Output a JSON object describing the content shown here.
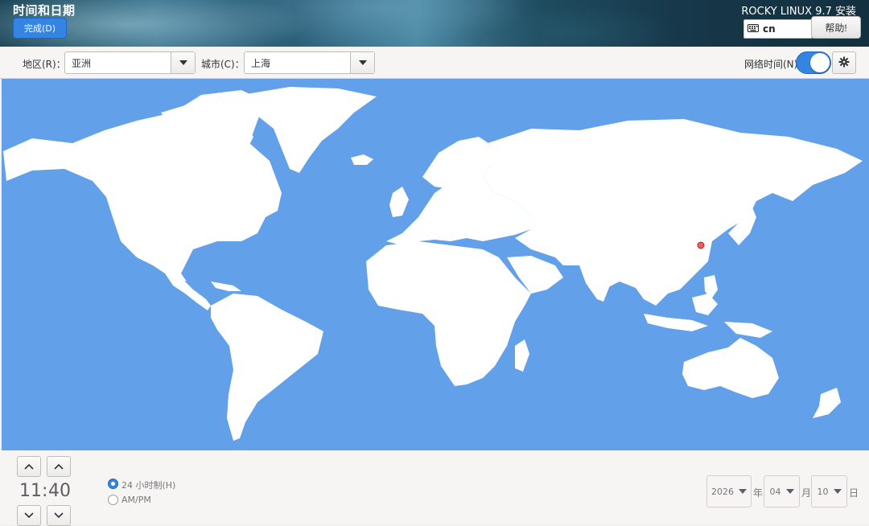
{
  "header": {
    "title": "时间和日期",
    "done_label": "完成(D)",
    "product": "ROCKY LINUX 9.7 安装",
    "keyboard_layout": "cn",
    "help_label": "帮助!"
  },
  "toolbar": {
    "region_label": "地区(R)：",
    "region_value": "亚洲",
    "city_label": "城市(C)：",
    "city_value": "上海",
    "network_time_label": "网络时间(N)",
    "network_time_enabled": true
  },
  "map": {
    "selected_city": "上海",
    "ocean_color": "#62a0ea",
    "land_color": "#ffffff",
    "marker_color": "#e66161"
  },
  "time": {
    "hours": "11",
    "separator": ":",
    "minutes": "40",
    "format_24h_label": "24 小时制(H)",
    "format_ampm_label": "AM/PM",
    "selected_format": "24h"
  },
  "date": {
    "year": "2026",
    "year_unit": "年",
    "month": "04",
    "month_unit": "月",
    "day": "10",
    "day_unit": "日"
  },
  "colors": {
    "accent": "#3584e4",
    "header_bg": "#2c5f78"
  }
}
